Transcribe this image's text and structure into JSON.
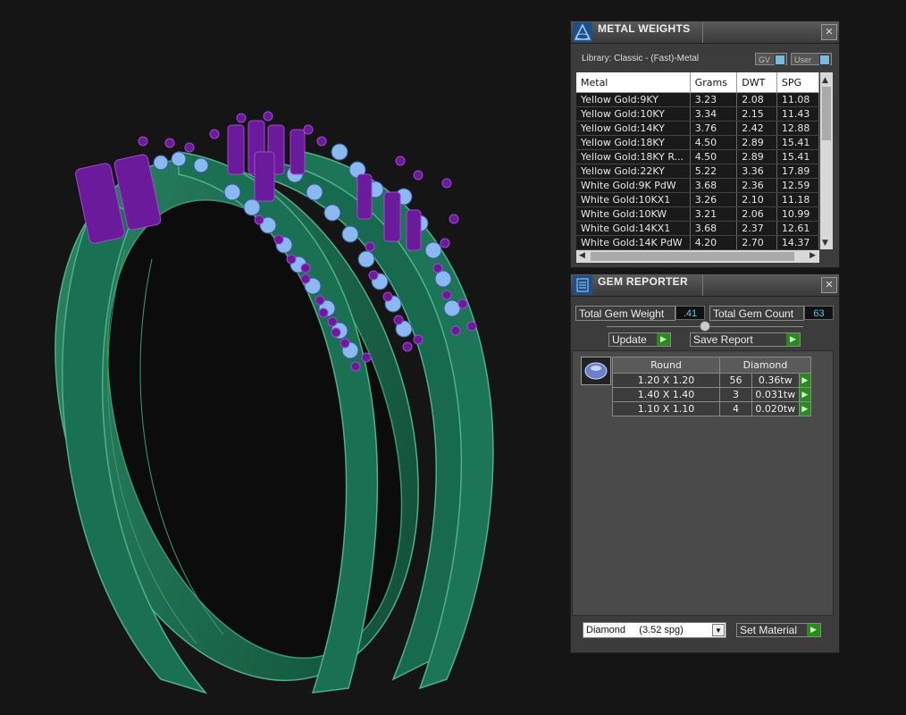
{
  "metal_weights": {
    "title": "METAL WEIGHTS",
    "close": "✕",
    "library": "Library: Classic - (Fast)-Metal",
    "toggle_gv": "GV",
    "toggle_user": "User",
    "columns": [
      "Metal",
      "Grams",
      "DWT",
      "SPG"
    ],
    "rows": [
      [
        "Yellow Gold:9KY",
        "3.23",
        "2.08",
        "11.08"
      ],
      [
        "Yellow Gold:10KY",
        "3.34",
        "2.15",
        "11.43"
      ],
      [
        "Yellow Gold:14KY",
        "3.76",
        "2.42",
        "12.88"
      ],
      [
        "Yellow Gold:18KY",
        "4.50",
        "2.89",
        "15.41"
      ],
      [
        "Yellow Gold:18KY R...",
        "4.50",
        "2.89",
        "15.41"
      ],
      [
        "Yellow Gold:22KY",
        "5.22",
        "3.36",
        "17.89"
      ],
      [
        "White Gold:9K PdW",
        "3.68",
        "2.36",
        "12.59"
      ],
      [
        "White Gold:10KX1",
        "3.26",
        "2.10",
        "11.18"
      ],
      [
        "White Gold:10KW",
        "3.21",
        "2.06",
        "10.99"
      ],
      [
        "White Gold:14KX1",
        "3.68",
        "2.37",
        "12.61"
      ],
      [
        "White Gold:14K PdW",
        "4.20",
        "2.70",
        "14.37"
      ]
    ]
  },
  "gem_reporter": {
    "title": "GEM REPORTER",
    "close": "✕",
    "total_weight_label": "Total Gem Weight",
    "total_weight_value": ".41",
    "total_count_label": "Total Gem Count",
    "total_count_value": "63",
    "update_label": "Update",
    "save_label": "Save Report",
    "table_headers": [
      "Round",
      "Diamond"
    ],
    "gems": [
      {
        "size": "1.20 X 1.20",
        "count": "56",
        "weight": "0.36tw"
      },
      {
        "size": "1.40 X 1.40",
        "count": "3",
        "weight": "0.031tw"
      },
      {
        "size": "1.10 X 1.10",
        "count": "4",
        "weight": "0.020tw"
      }
    ],
    "material_select": "Diamond     (3.52 spg)",
    "set_material_label": "Set Material"
  },
  "colors": {
    "ring_metal": "#1c6e52",
    "prongs": "#6a1a9a",
    "gems": "#8ab8f0"
  }
}
